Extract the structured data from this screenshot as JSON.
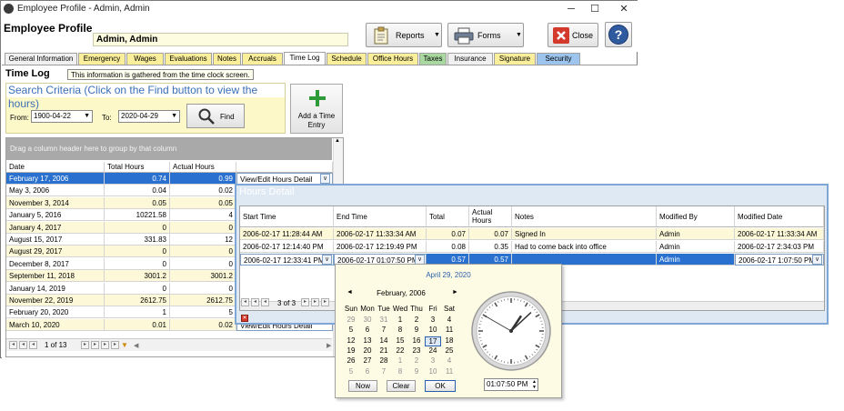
{
  "window": {
    "title": "Employee Profile - Admin, Admin",
    "minimize": "─",
    "maximize": "☐",
    "close": "✕"
  },
  "header": {
    "label": "Employee Profile",
    "employee_name": "Admin, Admin",
    "reports_label": "Reports",
    "forms_label": "Forms",
    "close_label": "Close",
    "help_label": "?"
  },
  "tabs": [
    {
      "label": "General Information",
      "color": "#f0f0f0"
    },
    {
      "label": "Emergency",
      "color": "#fbef9b"
    },
    {
      "label": "Wages",
      "color": "#fbef9b"
    },
    {
      "label": "Evaluations",
      "color": "#fbef9b"
    },
    {
      "label": "Notes",
      "color": "#fbef9b"
    },
    {
      "label": "Accruals",
      "color": "#fbef9b"
    },
    {
      "label": "Time Log",
      "color": "#ffffff"
    },
    {
      "label": "Schedule",
      "color": "#fbef9b"
    },
    {
      "label": "Office Hours",
      "color": "#fbef9b"
    },
    {
      "label": "Taxes",
      "color": "#a8d8a0"
    },
    {
      "label": "Insurance",
      "color": "#f0f0f0"
    },
    {
      "label": "Signature",
      "color": "#fbef9b"
    },
    {
      "label": "Security",
      "color": "#9cc4ec"
    }
  ],
  "timelog": {
    "title": "Time Log",
    "info": "This information is gathered from the time clock screen.",
    "search_title": "Search Criteria (Click on the Find button to view the hours)",
    "from_label": "From:",
    "from_value": "1900-04-22",
    "to_label": "To:",
    "to_value": "2020-04-29",
    "find_label": "Find",
    "add_label_1": "Add a Time",
    "add_label_2": "Entry",
    "group_hint": "Drag a column header here to group by that column",
    "columns": [
      "Date",
      "Total Hours",
      "Actual Hours",
      ""
    ],
    "rows": [
      {
        "date": "February 17, 2006",
        "total": "0.74",
        "actual": "0.99",
        "link": "View/Edit Hours Detail"
      },
      {
        "date": "May 3, 2006",
        "total": "0.04",
        "actual": "0.02",
        "link": ""
      },
      {
        "date": "November 3, 2014",
        "total": "0.05",
        "actual": "0.05",
        "link": ""
      },
      {
        "date": "January 5, 2016",
        "total": "10221.58",
        "actual": "4",
        "link": ""
      },
      {
        "date": "January 4, 2017",
        "total": "0",
        "actual": "0",
        "link": ""
      },
      {
        "date": "August 15, 2017",
        "total": "331.83",
        "actual": "12",
        "link": ""
      },
      {
        "date": "August 29, 2017",
        "total": "0",
        "actual": "0",
        "link": ""
      },
      {
        "date": "December 8, 2017",
        "total": "0",
        "actual": "0",
        "link": ""
      },
      {
        "date": "September 11, 2018",
        "total": "3001.2",
        "actual": "3001.2",
        "link": ""
      },
      {
        "date": "January 14, 2019",
        "total": "0",
        "actual": "0",
        "link": ""
      },
      {
        "date": "November 22, 2019",
        "total": "2612.75",
        "actual": "2612.75",
        "link": ""
      },
      {
        "date": "February 20, 2020",
        "total": "1",
        "actual": "5",
        "link": ""
      },
      {
        "date": "March 10, 2020",
        "total": "0.01",
        "actual": "0.02",
        "link": "View/Edit Hours Detail"
      }
    ],
    "pager": "1 of 13"
  },
  "hours_detail": {
    "title": "Hours Detail",
    "columns": [
      "Start Time",
      "End Time",
      "Total Hours",
      "Actual Hours",
      "Notes",
      "Modified By",
      "Modified Date"
    ],
    "rows": [
      {
        "start": "2006-02-17 11:28:44 AM",
        "end": "2006-02-17 11:33:34 AM",
        "total": "0.07",
        "actual": "0.07",
        "notes": "Signed In",
        "by": "Admin",
        "date": "2006-02-17 11:33:34 AM"
      },
      {
        "start": "2006-02-17 12:14:40 PM",
        "end": "2006-02-17 12:19:49 PM",
        "total": "0.08",
        "actual": "0.35",
        "notes": "Had to come back into office",
        "by": "Admin",
        "date": "2006-02-17 2:34:03 PM"
      },
      {
        "start": "2006-02-17 12:33:41 PM",
        "end": "2006-02-17 01:07:50 PM",
        "total": "0.57",
        "actual": "0.57",
        "notes": "",
        "by": "Admin",
        "date": "2006-02-17 1:07:50 PM"
      }
    ],
    "pager": "3 of 3"
  },
  "calendar": {
    "today": "April 29, 2020",
    "month": "February, 2006",
    "weekdays": [
      "Sun",
      "Mon",
      "Tue",
      "Wed",
      "Thu",
      "Fri",
      "Sat"
    ],
    "weeks": [
      [
        "29",
        "30",
        "31",
        "1",
        "2",
        "3",
        "4"
      ],
      [
        "5",
        "6",
        "7",
        "8",
        "9",
        "10",
        "11"
      ],
      [
        "12",
        "13",
        "14",
        "15",
        "16",
        "17",
        "18"
      ],
      [
        "19",
        "20",
        "21",
        "22",
        "23",
        "24",
        "25"
      ],
      [
        "26",
        "27",
        "28",
        "1",
        "2",
        "3",
        "4"
      ],
      [
        "5",
        "6",
        "7",
        "8",
        "9",
        "10",
        "11"
      ]
    ],
    "selected": "17",
    "now_label": "Now",
    "clear_label": "Clear",
    "ok_label": "OK",
    "time_value": "01:07:50 PM",
    "clock": {
      "hour": 1,
      "minute": 7,
      "second": 50
    }
  }
}
